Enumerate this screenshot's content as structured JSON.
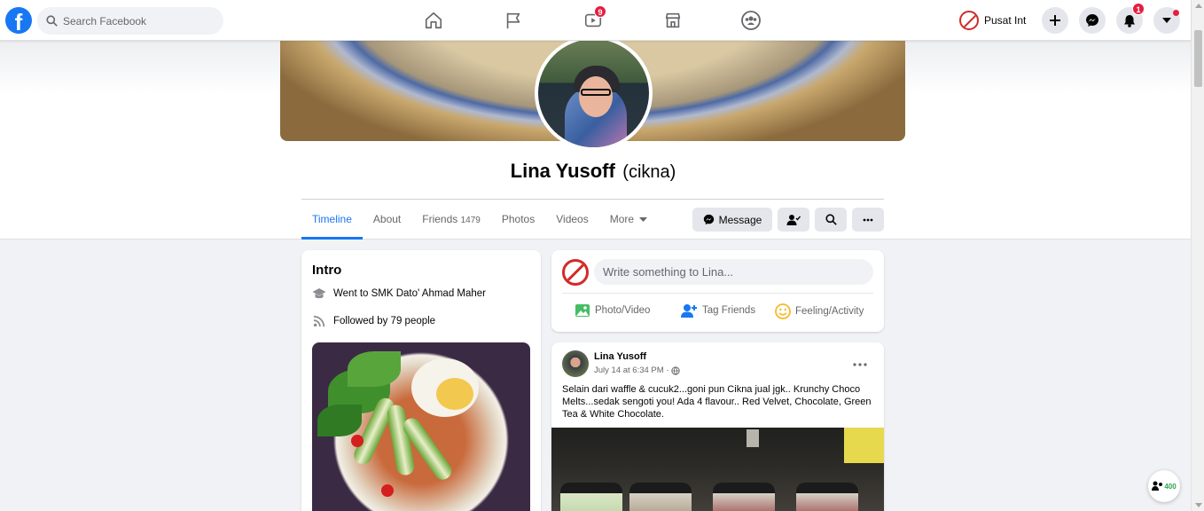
{
  "topbar": {
    "logo": "f",
    "search_placeholder": "Search Facebook",
    "nav_icons": [
      "home-icon",
      "flag-icon",
      "watch-icon",
      "marketplace-icon",
      "groups-icon"
    ],
    "watch_badge": "9",
    "profile_name": "Pusat Int",
    "notifications_badge": "1",
    "accent_color": "#1877f2",
    "badge_color": "#e41e3f"
  },
  "profile": {
    "name": "Lina Yusoff",
    "nickname": "(cikna)",
    "tabs": [
      {
        "label": "Timeline"
      },
      {
        "label": "About"
      },
      {
        "label": "Friends",
        "count": "1479"
      },
      {
        "label": "Photos"
      },
      {
        "label": "Videos"
      },
      {
        "label": "More"
      }
    ],
    "actions": {
      "message_label": "Message"
    }
  },
  "intro": {
    "title": "Intro",
    "went_to": "Went to SMK Dato' Ahmad Maher",
    "followed_by": "Followed by 79 people"
  },
  "composer": {
    "placeholder": "Write something to Lina...",
    "options": [
      "Photo/Video",
      "Tag Friends",
      "Feeling/Activity"
    ]
  },
  "post": {
    "author": "Lina Yusoff",
    "time": "July 14 at 6:34 PM ·",
    "text": "Selain dari waffle & cucuk2...goni pun Cikna jual jgk.. Krunchy Choco Melts...sedak sengoti you! Ada 4 flavour.. Red Velvet, Chocolate, Green Tea & White Chocolate."
  },
  "floating": {
    "count": "400"
  }
}
